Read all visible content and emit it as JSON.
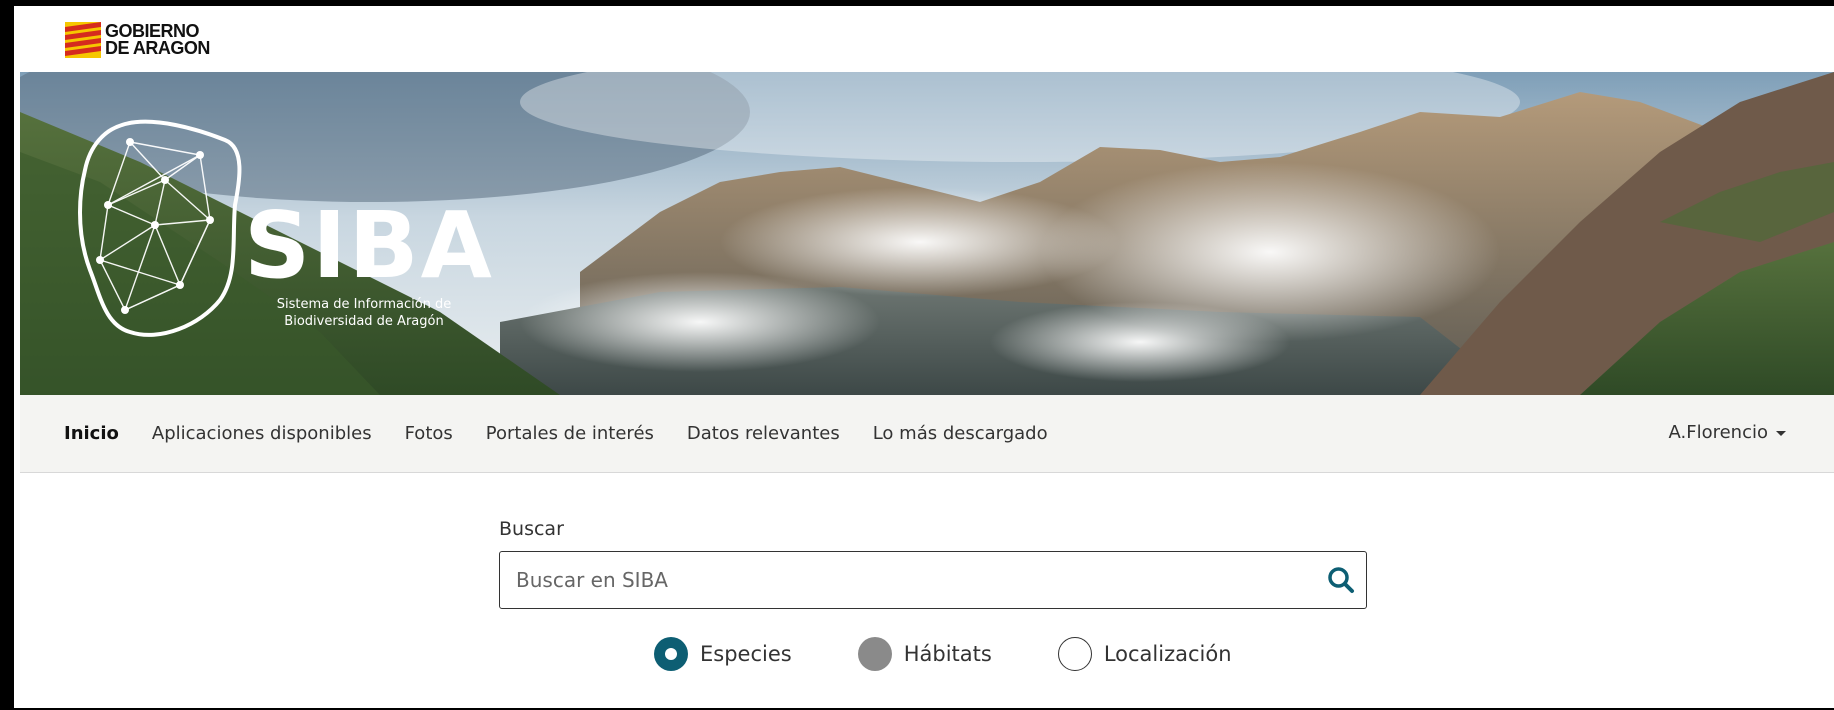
{
  "gov": {
    "line1": "GOBIERNO",
    "line2": "DE ARAGON"
  },
  "brand": {
    "title": "SIBA",
    "subtitle_line1": "Sistema de Información de",
    "subtitle_line2": "Biodiversidad de Aragón"
  },
  "nav": {
    "items": [
      {
        "label": "Inicio",
        "active": true
      },
      {
        "label": "Aplicaciones disponibles"
      },
      {
        "label": "Fotos"
      },
      {
        "label": "Portales de interés"
      },
      {
        "label": "Datos relevantes"
      },
      {
        "label": "Lo más descargado"
      }
    ],
    "user": "A.Florencio"
  },
  "search": {
    "label": "Buscar",
    "placeholder": "Buscar en SIBA",
    "icon": "search-icon",
    "options": [
      {
        "label": "Especies",
        "state": "checked"
      },
      {
        "label": "Hábitats",
        "state": "disabled"
      },
      {
        "label": "Localización",
        "state": "unchecked"
      }
    ]
  },
  "colors": {
    "accent": "#0d5e73",
    "nav_bg": "#f4f4f2",
    "flag_red": "#d52b1e",
    "flag_yellow": "#f6c700"
  }
}
